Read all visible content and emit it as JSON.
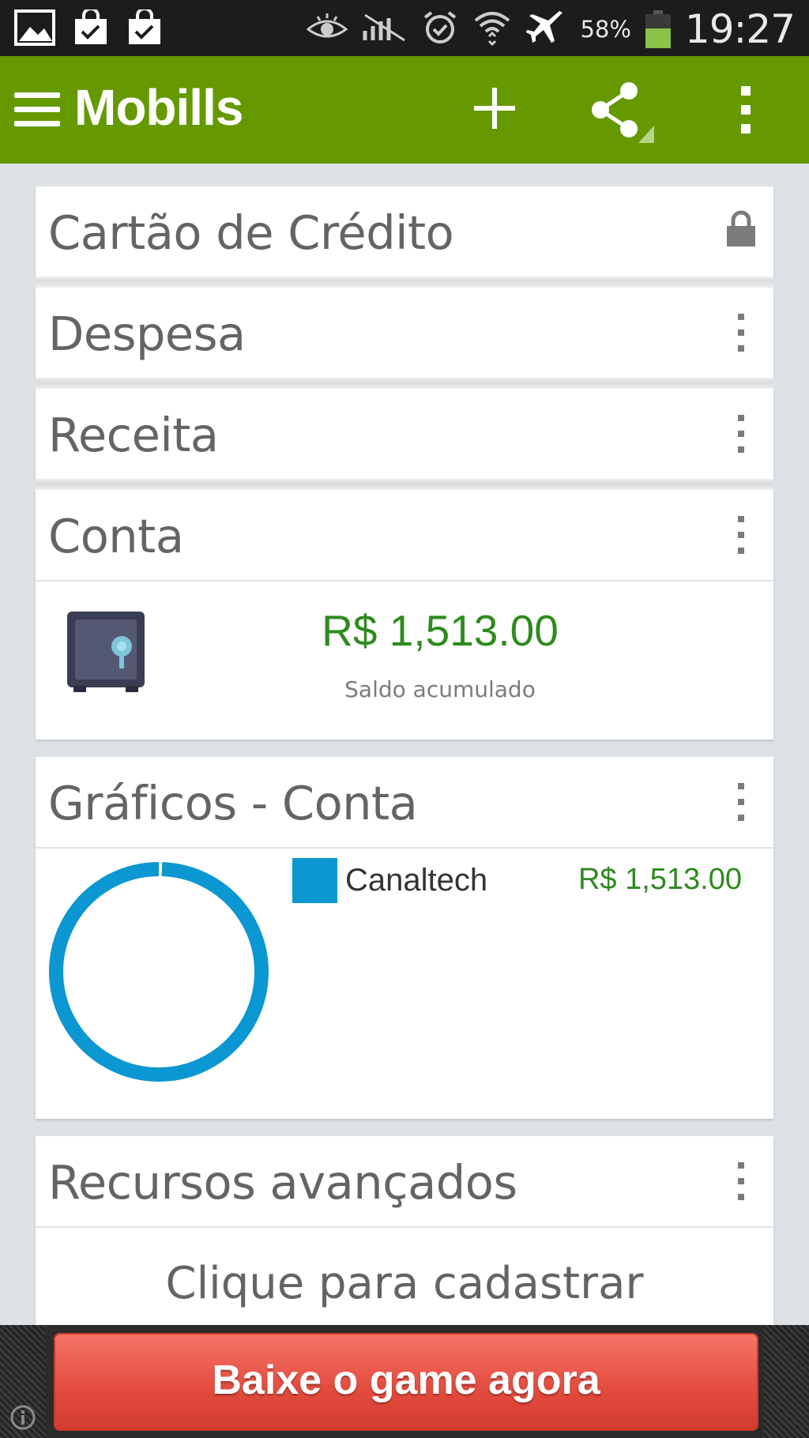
{
  "status_bar": {
    "battery_percent": "58%",
    "battery_level": 0.58,
    "time": "19:27",
    "icons": [
      "gallery-icon",
      "shopping-bag-icon",
      "shopping-bag-icon",
      "eye-icon",
      "no-signal-icon",
      "alarm-icon",
      "wifi-icon",
      "airplane-icon",
      "battery-icon"
    ]
  },
  "app_bar": {
    "title": "Mobills",
    "actions": [
      "add-icon",
      "share-icon",
      "overflow-menu-icon"
    ],
    "color": "#669900"
  },
  "cards": {
    "credit_card": {
      "title": "Cartão de Crédito"
    },
    "expense": {
      "title": "Despesa"
    },
    "income": {
      "title": "Receita"
    },
    "account": {
      "title": "Conta",
      "balance": "R$ 1,513.00",
      "balance_label": "Saldo acumulado"
    },
    "charts": {
      "title": "Gráficos - Conta",
      "legend_label": "Canaltech",
      "legend_value": "R$ 1,513.00"
    },
    "advanced": {
      "title": "Recursos avançados",
      "cta": "Clique para cadastrar"
    }
  },
  "chart_data": {
    "type": "pie",
    "categories": [
      "Canaltech"
    ],
    "values": [
      1513.0
    ],
    "colors": [
      "#0b97d1"
    ]
  },
  "ad": {
    "button_label": "Baixe o game agora"
  }
}
